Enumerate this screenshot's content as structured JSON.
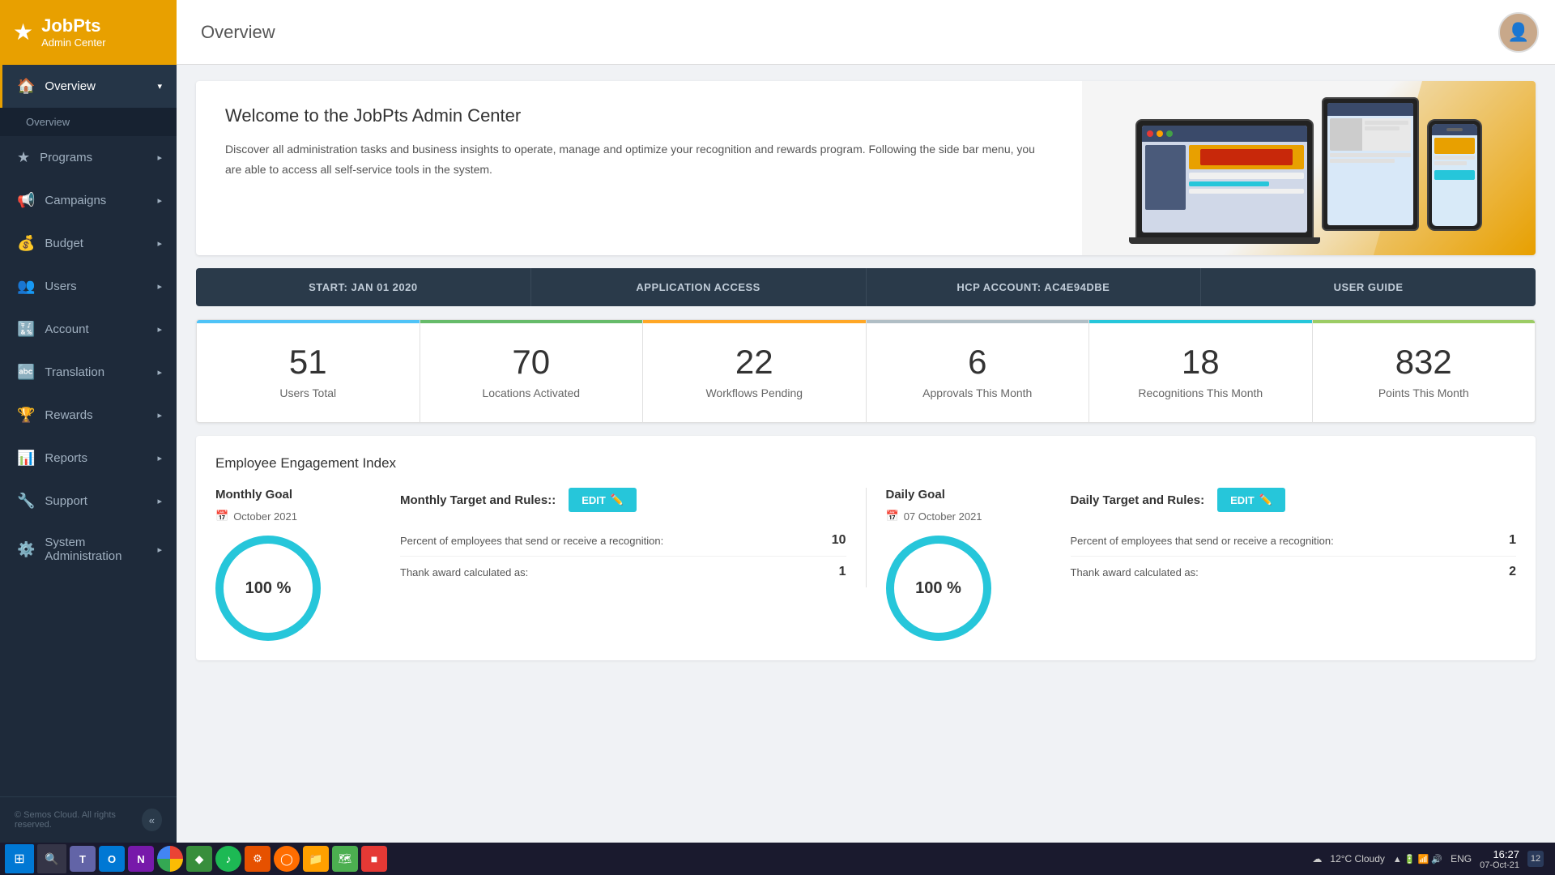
{
  "app": {
    "name": "JobPts",
    "sub": "Admin Center",
    "page_title": "Overview"
  },
  "sidebar": {
    "items": [
      {
        "id": "overview",
        "label": "Overview",
        "icon": "🏠",
        "active": true,
        "hasChevron": true
      },
      {
        "id": "overview-sub",
        "label": "Overview",
        "icon": "",
        "sub": true
      },
      {
        "id": "programs",
        "label": "Programs",
        "icon": "⭐",
        "hasChevron": true
      },
      {
        "id": "campaigns",
        "label": "Campaigns",
        "icon": "📢",
        "hasChevron": true
      },
      {
        "id": "budget",
        "label": "Budget",
        "icon": "💰",
        "hasChevron": true
      },
      {
        "id": "users",
        "label": "Users",
        "icon": "👥",
        "hasChevron": true
      },
      {
        "id": "account",
        "label": "Account",
        "icon": "🔣",
        "hasChevron": true
      },
      {
        "id": "translation",
        "label": "Translation",
        "icon": "🔤",
        "hasChevron": true
      },
      {
        "id": "rewards",
        "label": "Rewards",
        "icon": "🏆",
        "hasChevron": true
      },
      {
        "id": "reports",
        "label": "Reports",
        "icon": "📊",
        "hasChevron": true
      },
      {
        "id": "support",
        "label": "Support",
        "icon": "🔧",
        "hasChevron": true
      },
      {
        "id": "sysadmin",
        "label": "System Administration",
        "icon": "⚙️",
        "hasChevron": true
      }
    ],
    "footer": "© Semos Cloud. All rights reserved."
  },
  "info_bar": {
    "items": [
      {
        "id": "start-date",
        "label": "START: JAN 01 2020"
      },
      {
        "id": "app-access",
        "label": "APPLICATION ACCESS"
      },
      {
        "id": "hcp-account",
        "label": "HCP ACCOUNT: AC4E94DBE"
      },
      {
        "id": "user-guide",
        "label": "USER GUIDE"
      }
    ]
  },
  "stats": [
    {
      "id": "users-total",
      "number": "51",
      "label": "Users Total",
      "color": "blue"
    },
    {
      "id": "locations",
      "number": "70",
      "label": "Locations Activated",
      "color": "green"
    },
    {
      "id": "workflows",
      "number": "22",
      "label": "Workflows Pending",
      "color": "yellow"
    },
    {
      "id": "approvals",
      "number": "6",
      "label": "Approvals This Month",
      "color": "gray"
    },
    {
      "id": "recognitions",
      "number": "18",
      "label": "Recognitions This Month",
      "color": "teal"
    },
    {
      "id": "points",
      "number": "832",
      "label": "Points This Month",
      "color": "lime"
    }
  ],
  "welcome": {
    "title": "Welcome to the JobPts Admin Center",
    "body": "Discover all administration tasks and business insights to operate, manage and optimize your recognition and rewards program. Following the side bar menu, you are able to access all self-service tools in the system."
  },
  "engagement": {
    "section_title": "Employee Engagement Index",
    "monthly_goal": {
      "title": "Monthly Goal",
      "date": "October 2021",
      "percent": "100 %"
    },
    "monthly_rules": {
      "title": "Monthly Target and Rules::",
      "edit_label": "EDIT",
      "rules": [
        {
          "label": "Percent of employees that send or receive a recognition:",
          "value": "10"
        },
        {
          "label": "Thank award calculated as:",
          "value": "1"
        }
      ]
    },
    "daily_goal": {
      "title": "Daily Goal",
      "date": "07 October 2021",
      "percent": "100 %"
    },
    "daily_rules": {
      "title": "Daily Target and Rules:",
      "edit_label": "EDIT",
      "rules": [
        {
          "label": "Percent of employees that send or receive a recognition:",
          "value": "1"
        },
        {
          "label": "Thank award calculated as:",
          "value": "2"
        }
      ]
    }
  },
  "taskbar": {
    "apps": [
      {
        "id": "windows",
        "icon": "⊞",
        "color": "#0078d4"
      },
      {
        "id": "search",
        "icon": "🔍",
        "color": "transparent"
      },
      {
        "id": "teams",
        "icon": "T",
        "color": "#6264a7"
      },
      {
        "id": "outlook",
        "icon": "O",
        "color": "#0078d4"
      },
      {
        "id": "onenote",
        "icon": "N",
        "color": "#7719aa"
      },
      {
        "id": "chrome",
        "icon": "●",
        "color": "#4caf50"
      },
      {
        "id": "greenapp",
        "icon": "◆",
        "color": "#43a047"
      },
      {
        "id": "spotify",
        "icon": "♪",
        "color": "#1db954"
      },
      {
        "id": "orange",
        "icon": "⚙",
        "color": "#e65100"
      },
      {
        "id": "firefox",
        "icon": "◯",
        "color": "#ff6d00"
      },
      {
        "id": "folder",
        "icon": "📁",
        "color": "#ffa000"
      },
      {
        "id": "maps",
        "icon": "🗺",
        "color": "#4caf50"
      },
      {
        "id": "red",
        "icon": "■",
        "color": "#e53935"
      }
    ],
    "tray": {
      "weather": "☁",
      "temp": "12°C Cloudy",
      "lang": "ENG",
      "time": "16:27",
      "date": "07-Oct-21"
    }
  }
}
